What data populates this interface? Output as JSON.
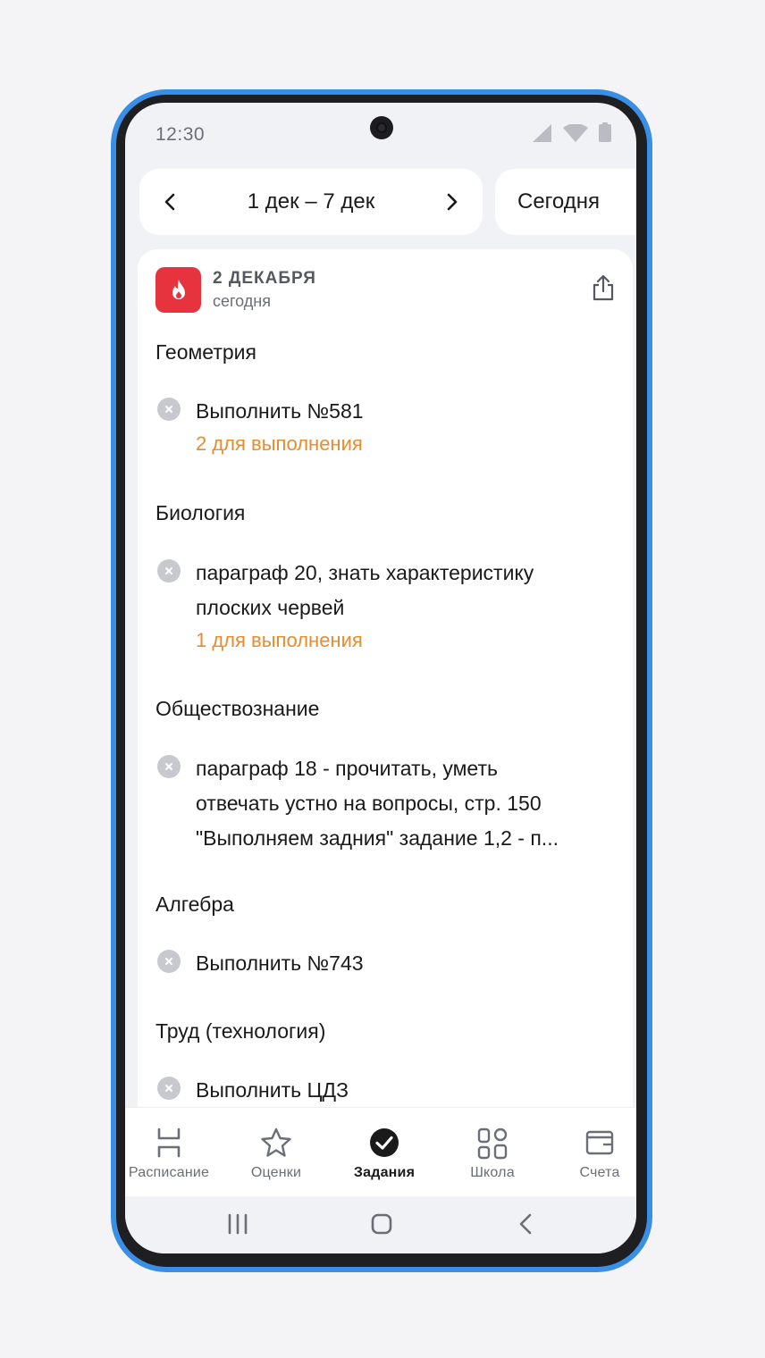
{
  "status_bar": {
    "time": "12:30"
  },
  "date_nav": {
    "range": "1 дек – 7 дек",
    "today_label": "Сегодня"
  },
  "day": {
    "title": "2 ДЕКАБРЯ",
    "subtitle": "сегодня"
  },
  "subjects": [
    {
      "name": "Геометрия",
      "tasks": [
        {
          "text": "Выполнить №581",
          "count": "2 для выполнения"
        }
      ]
    },
    {
      "name": "Биология",
      "tasks": [
        {
          "text_line1": "параграф 20, знать характеристику",
          "text_line2": "плоских червей",
          "count": "1 для выполнения"
        }
      ]
    },
    {
      "name": "Обществознание",
      "tasks": [
        {
          "text_line1": "параграф 18 - прочитать, уметь",
          "text_line2": "отвечать устно на вопросы, стр. 150",
          "text_line3": "\"Выполняем задния\" задание 1,2 - п..."
        }
      ]
    },
    {
      "name": "Алгебра",
      "tasks": [
        {
          "text": "Выполнить №743"
        }
      ]
    },
    {
      "name": "Труд (технология)",
      "tasks": [
        {
          "text": "Выполнить ЦДЗ"
        }
      ]
    }
  ],
  "bottom_nav": {
    "tabs": [
      {
        "label": "Расписание",
        "icon": "schedule-icon"
      },
      {
        "label": "Оценки",
        "icon": "star-icon"
      },
      {
        "label": "Задания",
        "icon": "check-circle-icon",
        "active": true
      },
      {
        "label": "Школа",
        "icon": "grid-icon"
      },
      {
        "label": "Счета",
        "icon": "wallet-icon"
      }
    ]
  },
  "colors": {
    "frame": "#3a8ee6",
    "badge": "#e6333d",
    "count_text": "#e98b2c",
    "background": "#f1f2f6"
  }
}
